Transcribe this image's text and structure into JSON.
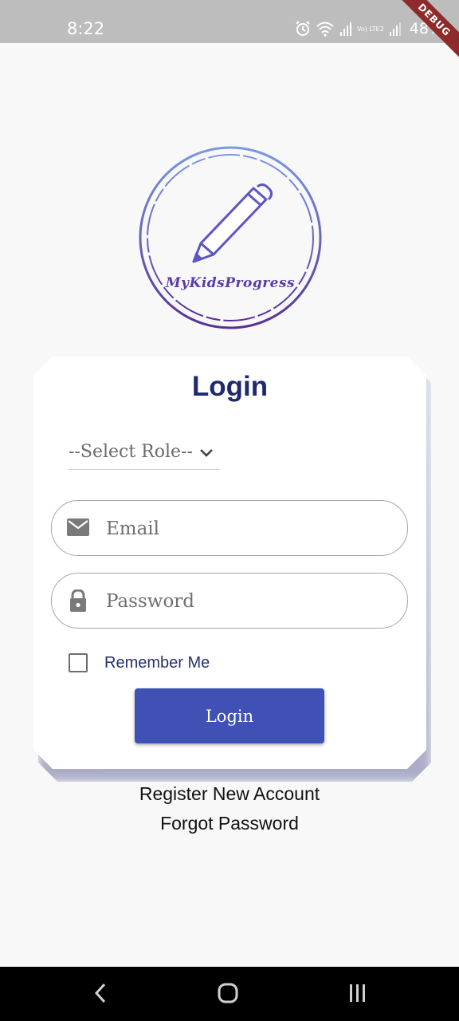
{
  "status_bar": {
    "time": "8:22",
    "battery": "48%",
    "network_label": "Vo) LTE2",
    "debug_banner": "DEBUG",
    "icons": [
      "alarm-icon",
      "wifi-icon",
      "signal-icon",
      "signal-icon",
      "battery-icon"
    ]
  },
  "logo": {
    "text": "MyKidsProgress",
    "icon": "pencil-icon"
  },
  "login_card": {
    "title": "Login",
    "role_select": {
      "value": "--Select Role--",
      "icon": "chevron-down-icon"
    },
    "email": {
      "placeholder": "Email",
      "value": "",
      "icon": "mail-icon"
    },
    "password": {
      "placeholder": "Password",
      "value": "",
      "icon": "lock-icon"
    },
    "remember_me": {
      "label": "Remember Me",
      "checked": false
    },
    "submit_label": "Login"
  },
  "links": {
    "register": "Register New Account",
    "forgot": "Forgot Password"
  },
  "nav_bar": [
    "back-icon",
    "home-icon",
    "recents-icon"
  ],
  "colors": {
    "accent": "#3f51b5",
    "title": "#1f2a6e",
    "logo_gradient_top": "#7a9ae0",
    "logo_gradient_bottom": "#5a2e96",
    "status_bar": "#bdbdbd",
    "background": "#f8f8f9"
  }
}
